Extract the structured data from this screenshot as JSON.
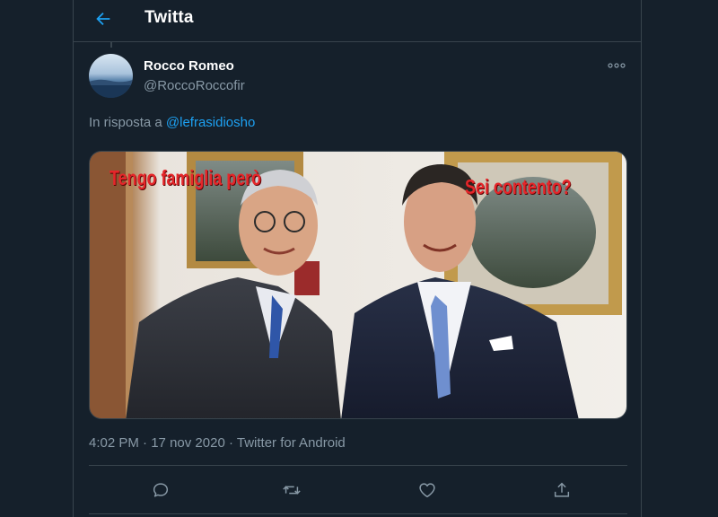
{
  "header": {
    "title": "Twitta"
  },
  "tweet": {
    "author_name": "Rocco Romeo",
    "author_handle": "@RoccoRoccofir",
    "reply_prefix": "In risposta a",
    "reply_mention": "@lefrasidiosho",
    "image_caption_left": "Tengo famiglia però",
    "image_caption_right": "Sei contento?",
    "time": "4:02 PM",
    "date": "17 nov 2020",
    "source": "Twitter for Android"
  },
  "colors": {
    "background": "#15202b",
    "border": "#38444d",
    "accent": "#1da1f2",
    "secondary_text": "#8899a6"
  },
  "icons": {
    "back": "arrow-left-icon",
    "more": "more-dots-icon",
    "reply": "reply-bubble-icon",
    "retweet": "retweet-icon",
    "like": "heart-icon",
    "share": "share-icon"
  }
}
